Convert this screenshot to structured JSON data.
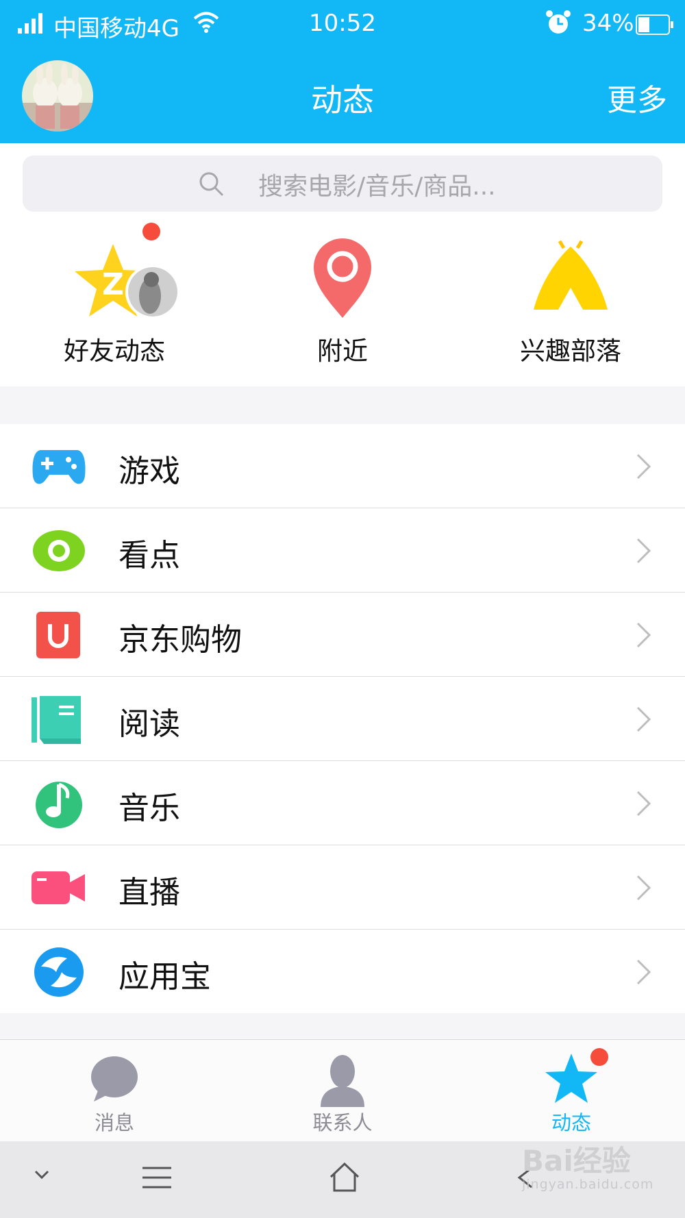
{
  "status_bar": {
    "carrier": "中国移动4G",
    "time": "10:52",
    "battery": "34%",
    "icons": [
      "signal-icon",
      "wifi-icon",
      "alarm-icon",
      "battery-icon"
    ]
  },
  "header": {
    "title": "动态",
    "more": "更多"
  },
  "search": {
    "placeholder": "搜索电影/音乐/商品..."
  },
  "quick_entries": [
    {
      "label": "好友动态",
      "icon": "friends-star-icon",
      "has_badge": true
    },
    {
      "label": "附近",
      "icon": "location-pin-icon"
    },
    {
      "label": "兴趣部落",
      "icon": "tent-icon"
    }
  ],
  "menu": [
    {
      "label": "游戏",
      "icon": "gamepad-icon",
      "color": "#2aa9f0"
    },
    {
      "label": "看点",
      "icon": "eye-icon",
      "color": "#7ed321"
    },
    {
      "label": "京东购物",
      "icon": "jd-bag-icon",
      "color": "#f2524a"
    },
    {
      "label": "阅读",
      "icon": "book-icon",
      "color": "#3ccfb4"
    },
    {
      "label": "音乐",
      "icon": "music-note-icon",
      "color": "#31c27c"
    },
    {
      "label": "直播",
      "icon": "video-camera-icon",
      "color": "#fb4f7e"
    },
    {
      "label": "应用宝",
      "icon": "app-store-icon",
      "color": "#1a9bf0"
    }
  ],
  "tabs": [
    {
      "label": "消息",
      "icon": "chat-bubble-icon",
      "active": false
    },
    {
      "label": "联系人",
      "icon": "person-icon",
      "active": false
    },
    {
      "label": "动态",
      "icon": "star-icon",
      "active": true,
      "has_badge": true
    }
  ],
  "system_nav": [
    "chevron-down-icon",
    "menu-icon",
    "home-icon",
    "back-icon"
  ],
  "watermark": {
    "brand": "Bai经验",
    "url": "jingyan.baidu.com"
  },
  "colors": {
    "accent": "#12b7f5",
    "badge": "#f64c3b"
  }
}
